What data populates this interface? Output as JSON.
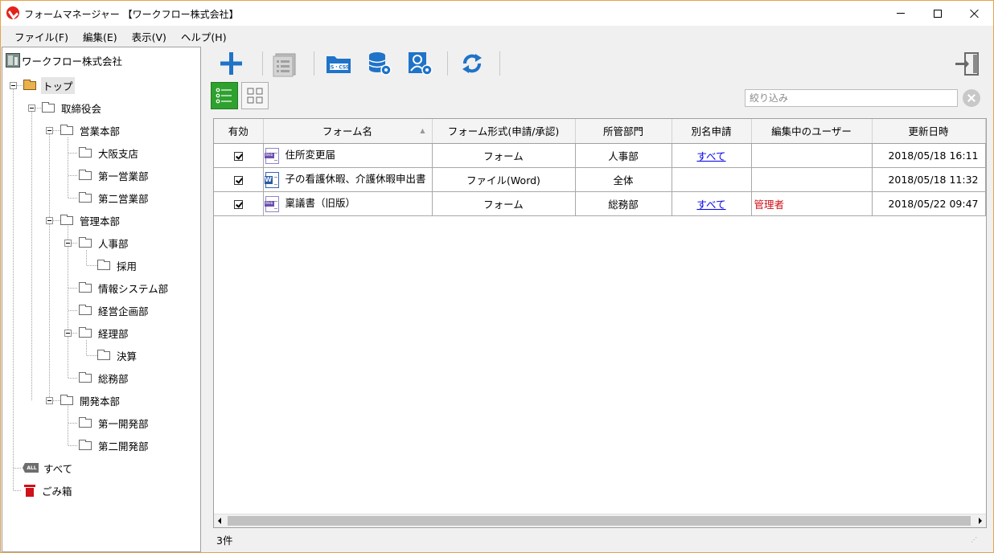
{
  "window": {
    "title": "フォームマネージャー 【ワークフロー株式会社】"
  },
  "menu": [
    "ファイル(F)",
    "編集(E)",
    "表示(V)",
    "ヘルプ(H)"
  ],
  "tree": {
    "root_label": "ワークフロー株式会社",
    "nodes": [
      {
        "label": "トップ",
        "level": 0,
        "selected": true
      },
      {
        "label": "取締役会",
        "level": 1
      },
      {
        "label": "営業本部",
        "level": 2
      },
      {
        "label": "大阪支店",
        "level": 3
      },
      {
        "label": "第一営業部",
        "level": 3
      },
      {
        "label": "第二営業部",
        "level": 3
      },
      {
        "label": "管理本部",
        "level": 2
      },
      {
        "label": "人事部",
        "level": 3
      },
      {
        "label": "採用",
        "level": 4
      },
      {
        "label": "情報システム部",
        "level": 3
      },
      {
        "label": "経営企画部",
        "level": 3
      },
      {
        "label": "経理部",
        "level": 3
      },
      {
        "label": "決算",
        "level": 4
      },
      {
        "label": "総務部",
        "level": 3
      },
      {
        "label": "開発本部",
        "level": 2
      },
      {
        "label": "第一開発部",
        "level": 3
      },
      {
        "label": "第二開発部",
        "level": 3
      }
    ],
    "all_label": "すべて",
    "all_badge": "ALL",
    "trash_label": "ごみ箱"
  },
  "toolbar": {
    "icons": [
      "add-icon",
      "list-icon",
      "js-css-folder-icon",
      "database-settings-icon",
      "user-settings-icon",
      "refresh-icon",
      "exit-icon"
    ],
    "jscss_badge": "JS・CSS"
  },
  "filter": {
    "placeholder": "絞り込み",
    "value": ""
  },
  "grid": {
    "columns": [
      "有効",
      "フォーム名",
      "フォーム形式(申請/承認)",
      "所管部門",
      "別名申請",
      "編集中のユーザー",
      "更新日時"
    ],
    "rows": [
      {
        "enabled": true,
        "icon": "web",
        "name": "住所変更届",
        "format": "フォーム",
        "dept": "人事部",
        "alias": "すべて",
        "editing_user": "",
        "updated": "2018/05/18 16:11"
      },
      {
        "enabled": true,
        "icon": "word",
        "name": "子の看護休暇、介護休暇申出書",
        "format": "ファイル(Word)",
        "dept": "全体",
        "alias": "",
        "editing_user": "",
        "updated": "2018/05/18 11:32"
      },
      {
        "enabled": true,
        "icon": "web",
        "name": "稟議書（旧版）",
        "format": "フォーム",
        "dept": "総務部",
        "alias": "すべて",
        "editing_user": "管理者",
        "updated": "2018/05/22 09:47"
      }
    ],
    "web_badge": "Web",
    "word_badge": "W"
  },
  "status": {
    "count": "3件"
  },
  "colors": {
    "accent_blue": "#1f73c8",
    "selected_view_green": "#2ea12e",
    "editing_user_red": "#d0101a",
    "window_border": "#e8a24f"
  }
}
